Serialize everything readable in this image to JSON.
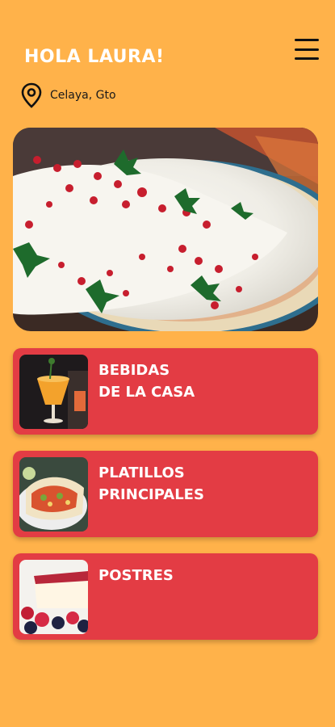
{
  "header": {
    "greeting": "HOLA LAURA!",
    "menu_icon": "hamburger-menu-icon"
  },
  "location": {
    "icon": "map-pin-icon",
    "text": "Celaya, Gto"
  },
  "hero": {
    "image": "chiles-en-nogada-dish"
  },
  "categories": [
    {
      "label": "BEBIDAS\nDE LA CASA",
      "image": "orange-cocktail"
    },
    {
      "label": "PLATILLOS\nPRINCIPALES",
      "image": "tacos-plate"
    },
    {
      "label": "POSTRES",
      "image": "cheesecake-with-berries"
    }
  ],
  "colors": {
    "background": "#FFB24A",
    "card": "#E33C44",
    "text_light": "#FFFFFF",
    "text_dark": "#1A1A1A"
  }
}
